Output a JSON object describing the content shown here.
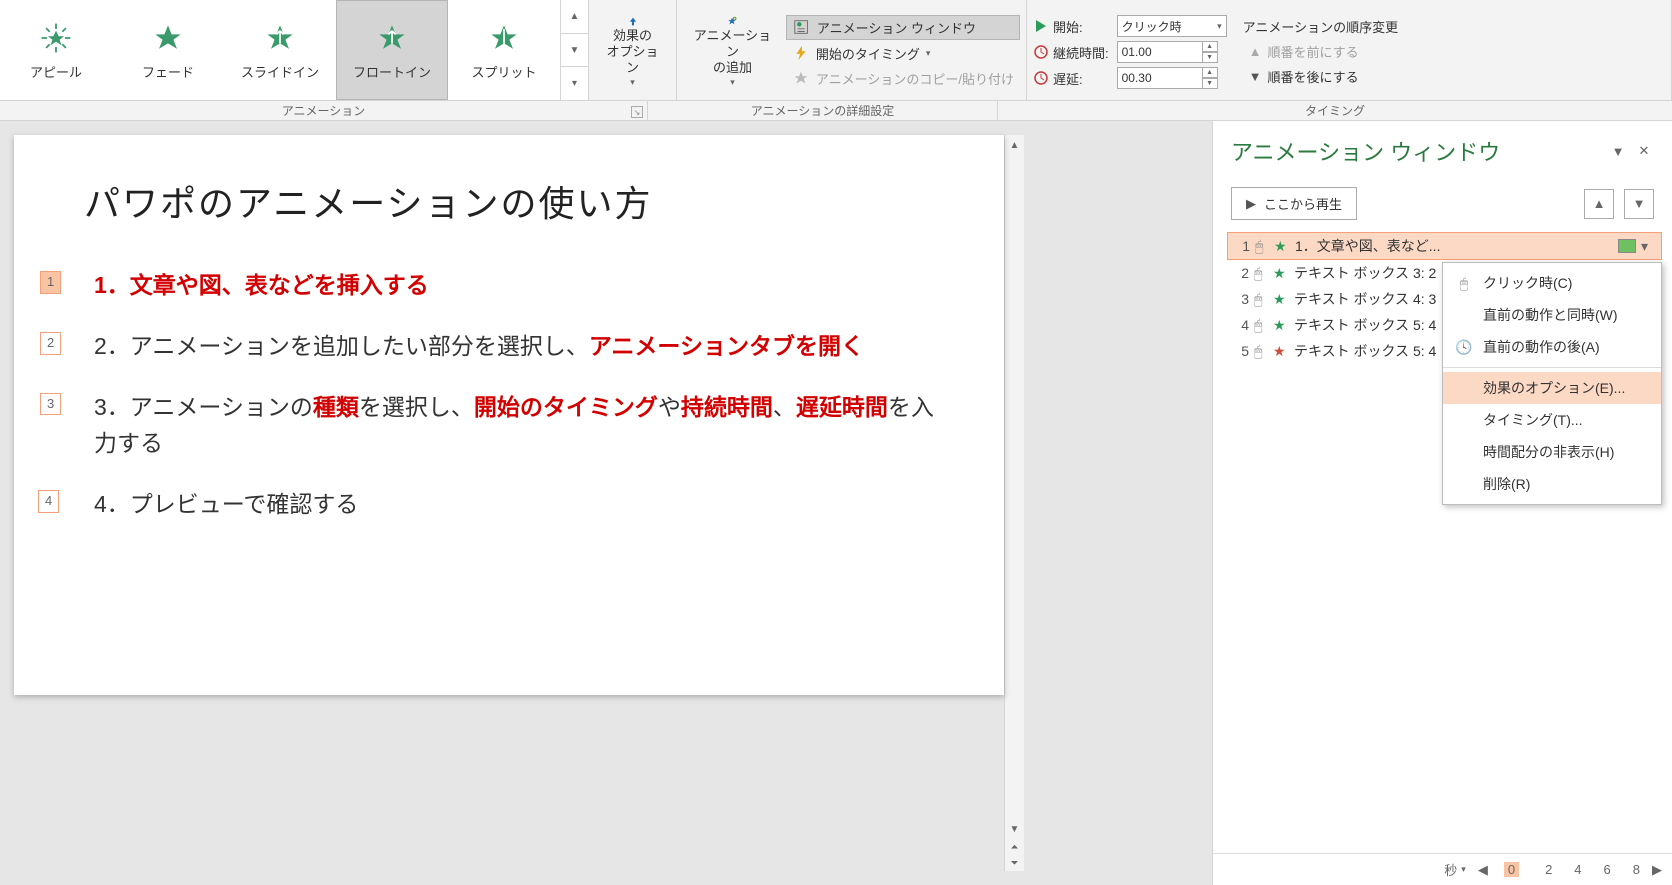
{
  "ribbon": {
    "gallery": [
      {
        "label": "アピール"
      },
      {
        "label": "フェード"
      },
      {
        "label": "スライドイン"
      },
      {
        "label": "フロートイン",
        "selected": true
      },
      {
        "label": "スプリット"
      }
    ],
    "effect_options_btn": "効果の\nオプション",
    "add_animation_btn": "アニメーション\nの追加",
    "detail": {
      "anim_window": "アニメーション ウィンドウ",
      "start_timing": "開始のタイミング",
      "anim_copy": "アニメーションのコピー/貼り付け"
    },
    "timing": {
      "start_label": "開始:",
      "start_value": "クリック時",
      "duration_label": "継続時間:",
      "duration_value": "01.00",
      "delay_label": "遅延:",
      "delay_value": "00.30",
      "order_title": "アニメーションの順序変更",
      "order_forward": "順番を前にする",
      "order_back": "順番を後にする"
    }
  },
  "group_labels": {
    "animation": "アニメーション",
    "detail": "アニメーションの詳細設定",
    "timing": "タイミング"
  },
  "slide": {
    "title": "パワポのアニメーションの使い方",
    "tags": [
      "1",
      "2",
      "3",
      "4"
    ],
    "b1_num": "1．",
    "b1_text": "文章や図、表などを挿入する",
    "b2_num": "2．",
    "b2_a": "アニメーションを追加したい部分を選択し、",
    "b2_b": "アニメーションタブを開く",
    "b3_num": "3．",
    "b3_a": "アニメーションの",
    "b3_b": "種類",
    "b3_c": "を選択し、",
    "b3_d": "開始のタイミング",
    "b3_e": "や",
    "b3_f": "持続時間",
    "b3_g": "、",
    "b3_h": "遅延時間",
    "b3_i": "を入力する",
    "b4_num": "4．",
    "b4_text": "プレビューで確認する"
  },
  "pane": {
    "title": "アニメーション ウィンドウ",
    "play_from_here": "ここから再生",
    "items": [
      {
        "num": "1",
        "label": "1．文章や図、表など...",
        "star": "green",
        "selected": true,
        "bar_color": "#6ec060"
      },
      {
        "num": "2",
        "label": "テキスト ボックス 3: 2",
        "star": "green"
      },
      {
        "num": "3",
        "label": "テキスト ボックス 4: 3",
        "star": "green"
      },
      {
        "num": "4",
        "label": "テキスト ボックス 5: 4",
        "star": "green"
      },
      {
        "num": "5",
        "label": "テキスト ボックス 5: 4",
        "star": "red"
      }
    ],
    "context_menu": [
      {
        "label": "クリック時(C)",
        "icon": "mouse"
      },
      {
        "label": "直前の動作と同時(W)",
        "icon": ""
      },
      {
        "label": "直前の動作の後(A)",
        "icon": "clock"
      },
      {
        "sep": true
      },
      {
        "label": "効果のオプション(E)...",
        "highlight": true
      },
      {
        "label": "タイミング(T)..."
      },
      {
        "label": "時間配分の非表示(H)"
      },
      {
        "label": "削除(R)"
      }
    ],
    "footer": {
      "sec_label": "秒",
      "ticks": [
        "0",
        "2",
        "4",
        "6",
        "8"
      ]
    }
  }
}
